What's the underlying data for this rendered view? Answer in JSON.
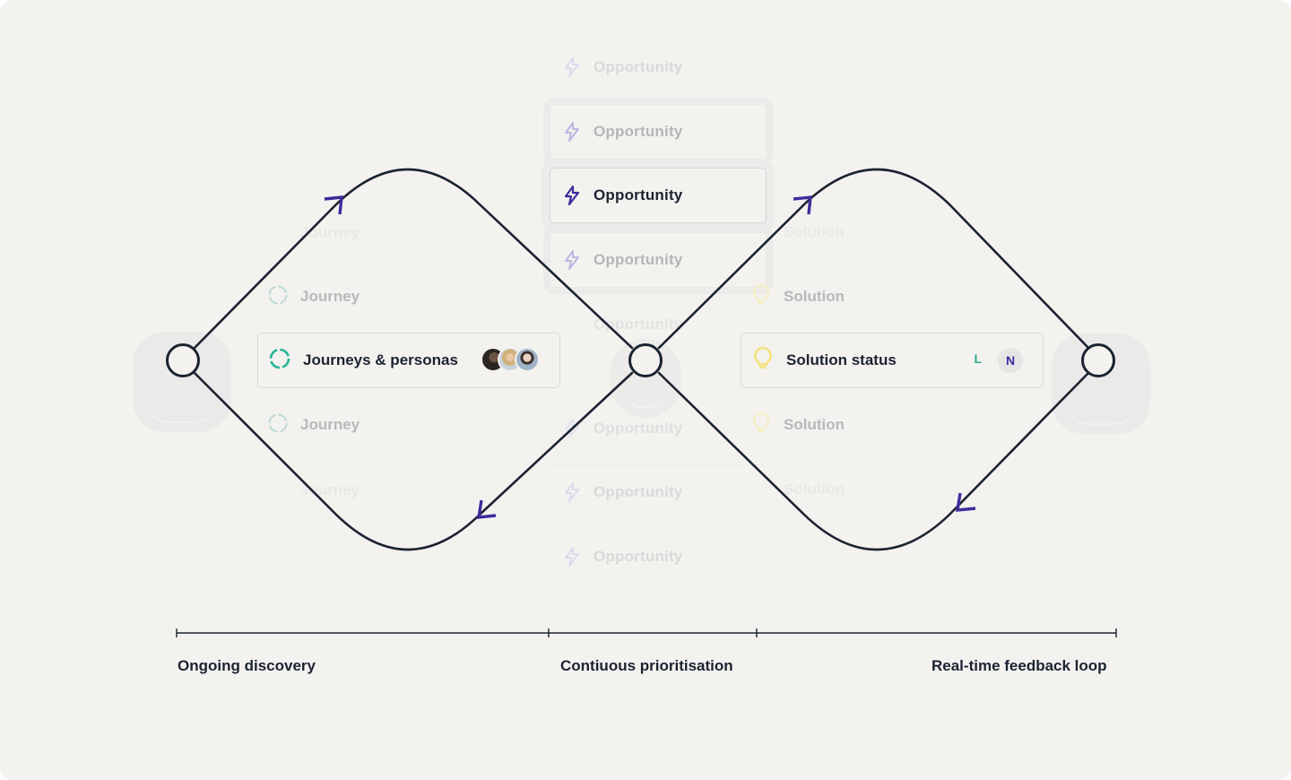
{
  "colors": {
    "background": "#f4f2ef",
    "line": "#1b2331",
    "arrow": "#3f2c9c",
    "opportunity_icon": "#3f2c9c",
    "journey_icon": "#27b496",
    "solution_icon": "#f5e27a",
    "text_dark": "#1b2331"
  },
  "opportunity_column": {
    "items": [
      {
        "label": "Opportunity",
        "icon": "lightning-icon",
        "state": "faint"
      },
      {
        "label": "Opportunity",
        "icon": "lightning-icon",
        "state": "dim"
      },
      {
        "label": "Opportunity",
        "icon": "lightning-icon",
        "state": "active"
      },
      {
        "label": "Opportunity",
        "icon": "lightning-icon",
        "state": "dim"
      },
      {
        "label": "Opportunity",
        "icon": "lightning-icon",
        "state": "faint"
      },
      {
        "label": "Opportunity",
        "icon": "lightning-icon",
        "state": "faint"
      },
      {
        "label": "Opportunity",
        "icon": "lightning-icon",
        "state": "faint"
      },
      {
        "label": "Opportunity",
        "icon": "lightning-icon",
        "state": "faint"
      }
    ]
  },
  "journey_column": {
    "items": [
      {
        "label": "Journey",
        "state": "faint"
      },
      {
        "label": "Journey",
        "state": "dim"
      },
      {
        "label": "Journey",
        "state": "dim"
      },
      {
        "label": "Journey",
        "state": "faint"
      }
    ],
    "main_card": {
      "label": "Journeys & personas",
      "icon": "progress-ring-icon",
      "avatars": [
        "avatar-person-1",
        "avatar-person-2",
        "avatar-person-3"
      ]
    }
  },
  "solution_column": {
    "items": [
      {
        "label": "Solution",
        "state": "faint"
      },
      {
        "label": "Solution",
        "state": "dim"
      },
      {
        "label": "Solution",
        "state": "dim"
      },
      {
        "label": "Solution",
        "state": "faint"
      }
    ],
    "main_card": {
      "label": "Solution status",
      "icon": "lightbulb-icon",
      "badges": [
        "L",
        "N"
      ]
    }
  },
  "timeline": {
    "labels": [
      "Ongoing discovery",
      "Contiuous prioritisation",
      "Real-time feedback loop"
    ]
  }
}
